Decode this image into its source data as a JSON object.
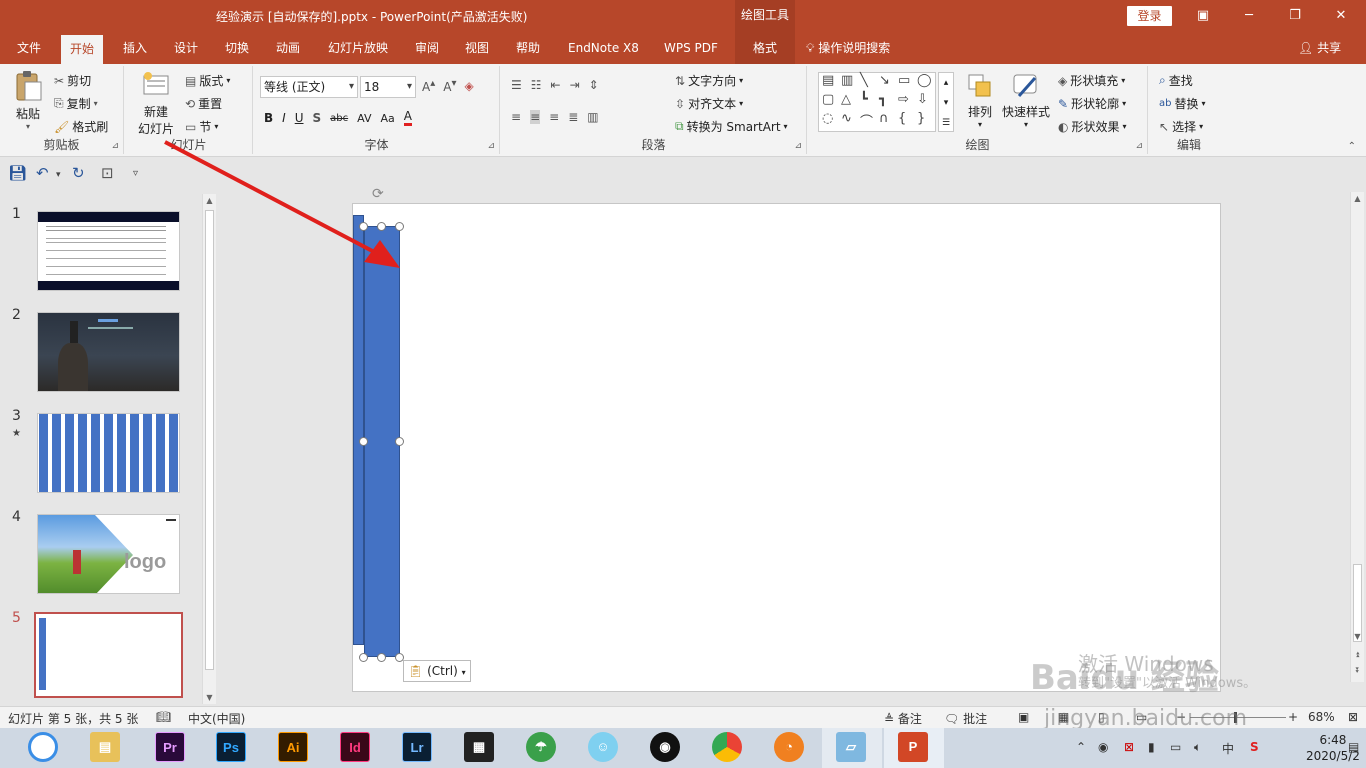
{
  "window": {
    "title": "经验演示 [自动保存的].pptx  -  PowerPoint(产品激活失败)",
    "context_tool": "绘图工具",
    "login": "登录"
  },
  "tabs": [
    "文件",
    "开始",
    "插入",
    "设计",
    "切换",
    "动画",
    "幻灯片放映",
    "审阅",
    "视图",
    "帮助",
    "EndNote X8",
    "WPS PDF",
    "格式"
  ],
  "tell_me": "操作说明搜索",
  "share": "共享",
  "ribbon": {
    "clipboard": {
      "paste": "粘贴",
      "cut": "剪切",
      "copy": "复制",
      "format_painter": "格式刷",
      "label": "剪贴板"
    },
    "slides": {
      "new_slide_1": "新建",
      "new_slide_2": "幻灯片",
      "layout": "版式",
      "reset": "重置",
      "section": "节",
      "label": "幻灯片"
    },
    "font": {
      "font_name": "等线 (正文)",
      "font_size": "18",
      "label": "字体",
      "bold": "B",
      "italic": "I",
      "underline": "U",
      "shadow": "S",
      "strike": "abc",
      "spacing": "AV",
      "case": "Aa",
      "color": "A"
    },
    "paragraph": {
      "text_direction": "文字方向",
      "align_text": "对齐文本",
      "convert_smartart": "转换为 SmartArt",
      "label": "段落"
    },
    "drawing": {
      "arrange": "排列",
      "quick_styles": "快速样式",
      "shape_fill": "形状填充",
      "shape_outline": "形状轮廓",
      "shape_effects": "形状效果",
      "label": "绘图"
    },
    "editing": {
      "find": "查找",
      "replace": "替换",
      "select": "选择",
      "label": "编辑"
    }
  },
  "slides": [
    {
      "num": "1",
      "kind": "text"
    },
    {
      "num": "2",
      "kind": "photo"
    },
    {
      "num": "3",
      "kind": "bars",
      "star": "★"
    },
    {
      "num": "4",
      "kind": "logo",
      "logo_text": "logo"
    },
    {
      "num": "5",
      "kind": "current"
    }
  ],
  "paste_options": "(Ctrl)",
  "status": {
    "slide_info": "幻灯片 第 5 张，共 5 张",
    "language": "中文(中国)",
    "notes": "备注",
    "comments": "批注",
    "zoom": "68%"
  },
  "watermarks": {
    "activate_1": "激活 Windows",
    "activate_2": "转到\"设置\"以激活 Windows。",
    "baidu": "Baidu 经验",
    "url": "jingyan.baidu.com"
  },
  "taskbar": {
    "apps": [
      "Pr",
      "Ps",
      "Ai",
      "Id",
      "Lr"
    ],
    "time": "6:48",
    "date": "2020/5/2",
    "ime": "中"
  },
  "colors": {
    "accent": "#b7472a",
    "shape_fill": "#4472c4",
    "arrow": "#e0201c"
  }
}
